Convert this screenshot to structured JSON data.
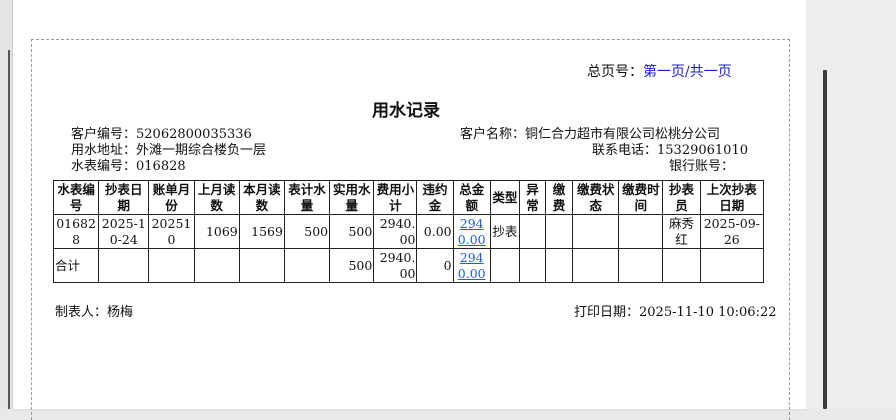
{
  "page_label": "总页号：",
  "page_info": "第一页/共一页",
  "title": "用水记录",
  "customer_no_label": "客户编号：",
  "customer_no": "52062800035336",
  "customer_name_label": "客户名称：",
  "customer_name": "铜仁合力超市有限公司松桃分公司",
  "address_label": "用水地址：",
  "address": "外滩一期综合楼负一层",
  "phone_label": "联系电话：",
  "phone": "15329061010",
  "meter_no_label": "水表编号：",
  "meter_no": "016828",
  "bank_label": "银行账号：",
  "bank_account": "",
  "table": {
    "headers": [
      "水表编号",
      "抄表日期",
      "账单月份",
      "上月读数",
      "本月读数",
      "表计水量",
      "实用水量",
      "费用小计",
      "违约金",
      "总金额",
      "类型",
      "异常",
      "缴费",
      "缴费状态",
      "缴费时间",
      "抄表员",
      "上次抄表日期"
    ],
    "row": {
      "meter_no": "016828",
      "read_date": "2025-10-24",
      "bill_month": "202510",
      "last_reading": "1069",
      "this_reading": "1569",
      "meter_volume": "500",
      "actual_volume": "500",
      "fee_subtotal": "2940.00",
      "penalty": "0.00",
      "total_amount": "2940.00",
      "type": "抄表",
      "abnormal": "",
      "paid": "",
      "pay_status": "",
      "pay_time": "",
      "reader": "麻秀红",
      "last_read_date": "2025-09-26"
    },
    "total_row": {
      "label": "合计",
      "actual_volume": "500",
      "fee_subtotal": "2940.00",
      "penalty": "0",
      "total_amount": "2940.00"
    }
  },
  "maker_label": "制表人：",
  "maker": "杨梅",
  "print_date_label": "打印日期：",
  "print_date": "2025-11-10 10:06:22"
}
